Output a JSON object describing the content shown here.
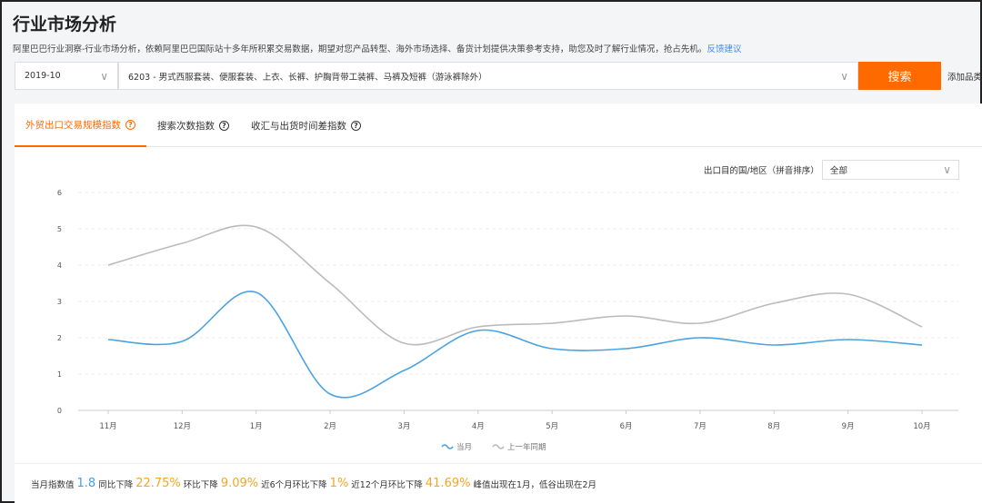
{
  "header": {
    "title": "行业市场分析",
    "description": "阿里巴巴行业洞察-行业市场分析，依赖阿里巴巴国际站十多年所积累交易数据，期望对您产品转型、海外市场选择、备货计划提供决策参考支持，助您及时了解行业情况，抢占先机。",
    "feedback_link": "反馈建议"
  },
  "search": {
    "date": "2019-10",
    "category": "6203 - 男式西服套装、便服套装、上衣、长裤、护胸背带工装裤、马裤及短裤（游泳裤除外）",
    "button": "搜索",
    "add": "添加品类"
  },
  "tabs": [
    {
      "label": "外贸出口交易规模指数",
      "active": true
    },
    {
      "label": "搜索次数指数"
    },
    {
      "label": "收汇与出货时间差指数"
    }
  ],
  "filter": {
    "label": "出口目的国/地区（拼音排序）",
    "value": "全部"
  },
  "colors": {
    "accent": "#ff6a00",
    "current": "#4aa3df",
    "last_year": "#bbbbbb"
  },
  "chart_data": {
    "type": "line",
    "categories": [
      "11月",
      "12月",
      "1月",
      "2月",
      "3月",
      "4月",
      "5月",
      "6月",
      "7月",
      "8月",
      "9月",
      "10月"
    ],
    "ylim": [
      0,
      6
    ],
    "yticks": [
      0,
      1,
      2,
      3,
      4,
      5,
      6
    ],
    "grid": true,
    "legend_placement": "bottom",
    "series": [
      {
        "name": "当月",
        "values": [
          1.95,
          1.9,
          3.25,
          0.45,
          1.1,
          2.2,
          1.7,
          1.7,
          2.0,
          1.8,
          1.95,
          1.8
        ]
      },
      {
        "name": "上一年同期",
        "values": [
          4.0,
          4.6,
          5.05,
          3.5,
          1.85,
          2.3,
          2.4,
          2.6,
          2.4,
          2.95,
          3.2,
          2.3
        ]
      }
    ]
  },
  "summary": {
    "l1": "当月指数值",
    "v1": "1.8",
    "l2": "同比下降",
    "v2": "22.75%",
    "l3": "环比下降",
    "v3": "9.09%",
    "l4": "近6个月环比下降",
    "v4": "1%",
    "l5": "近12个月环比下降",
    "v5": "41.69%",
    "l6": "峰值出现在1月，低谷出现在2月"
  }
}
